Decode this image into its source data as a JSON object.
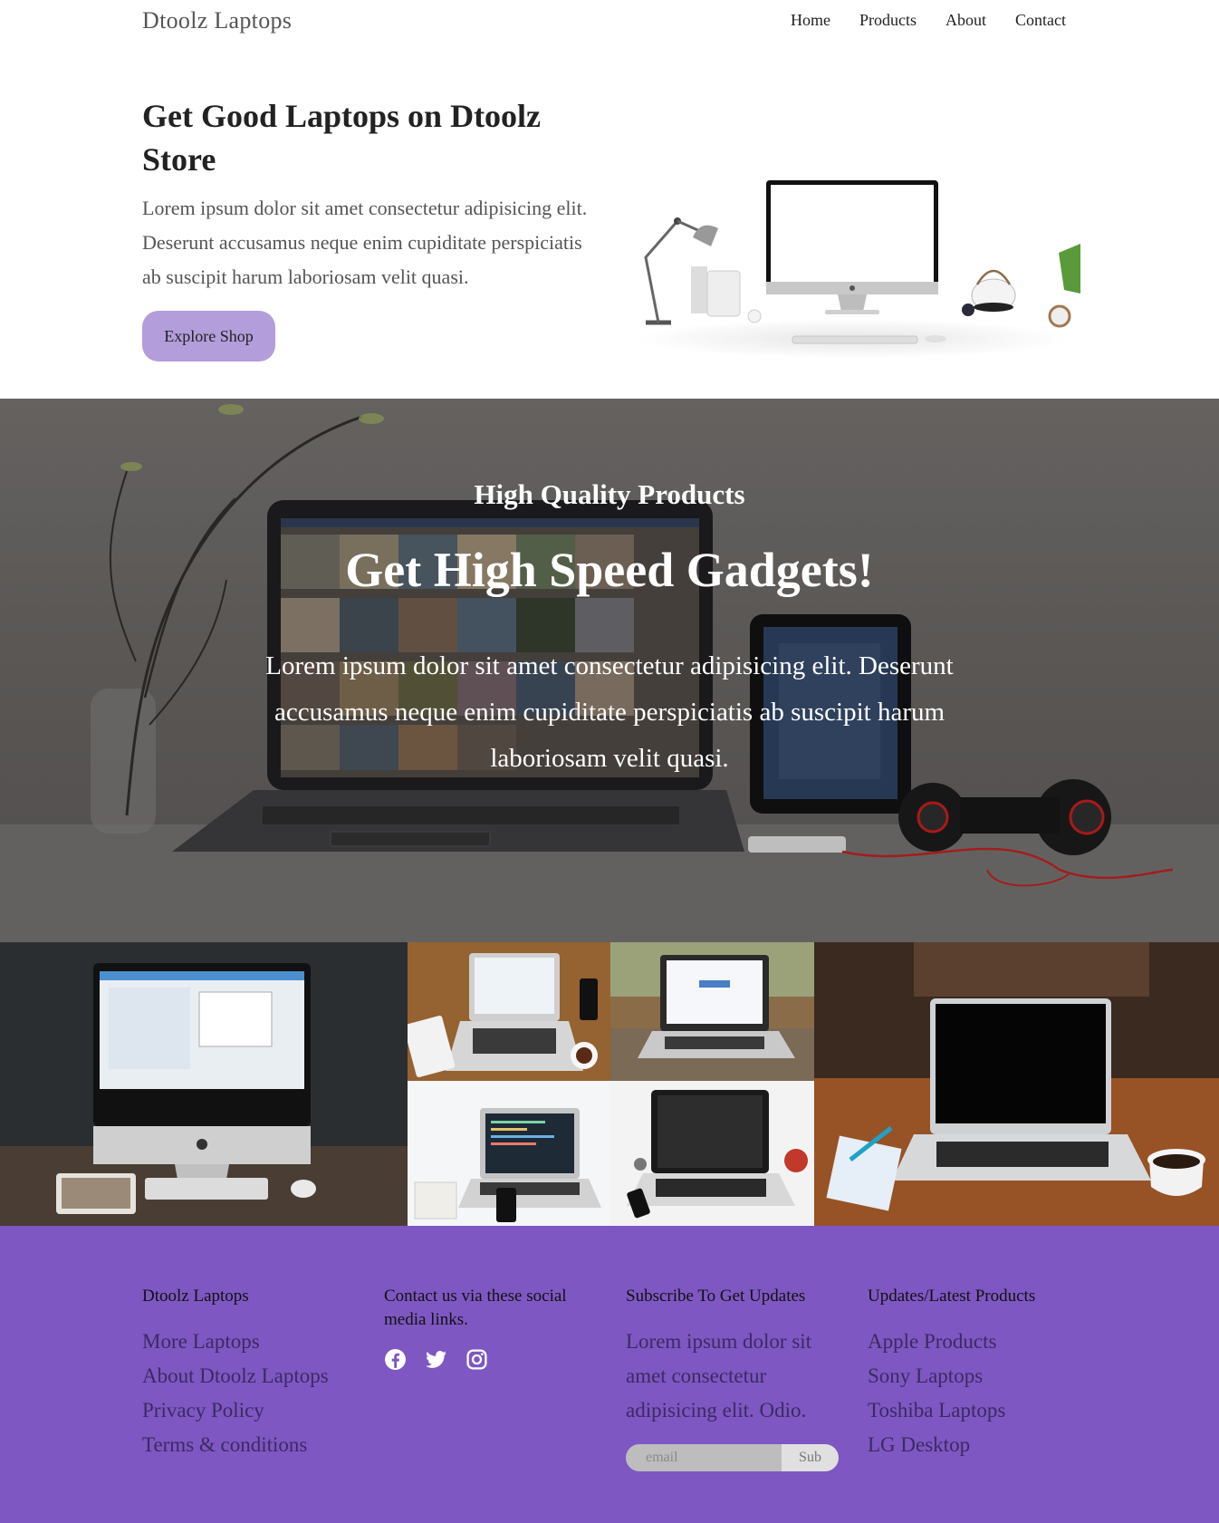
{
  "nav": {
    "brand": "Dtoolz Laptops",
    "links": [
      "Home",
      "Products",
      "About",
      "Contact"
    ]
  },
  "hero": {
    "title": "Get Good Laptops on Dtoolz Store",
    "text": "Lorem ipsum dolor sit amet consectetur adipisicing elit. Deserunt accusamus neque enim cupiditate perspiciatis ab suscipit harum laboriosam velit quasi.",
    "button_label": "Explore Shop"
  },
  "banner": {
    "subtitle": "High Quality Products",
    "title": "Get High Speed Gadgets!",
    "text": "Lorem ipsum dolor sit amet consectetur adipisicing elit. Deserunt accusamus neque enim cupiditate perspiciatis ab suscipit harum laboriosam velit quasi."
  },
  "footer": {
    "col1": {
      "heading": "Dtoolz Laptops",
      "links": [
        "More Laptops",
        "About Dtoolz Laptops",
        "Privacy Policy",
        "Terms & conditions"
      ]
    },
    "col2": {
      "heading": "Contact us via these social media links.",
      "icons": [
        "facebook-icon",
        "twitter-icon",
        "instagram-icon"
      ]
    },
    "col3": {
      "heading": "Subscribe To Get Updates",
      "text": "Lorem ipsum dolor sit amet consectetur adipisicing elit. Odio.",
      "email_placeholder": "email",
      "button_label": "Sub"
    },
    "col4": {
      "heading": "Updates/Latest Products",
      "links": [
        "Apple Products",
        "Sony Laptops",
        "Toshiba Laptops",
        "LG Desktop"
      ]
    }
  },
  "colors": {
    "accent_button": "#b39ddb",
    "footer_bg": "#7e57c2"
  }
}
